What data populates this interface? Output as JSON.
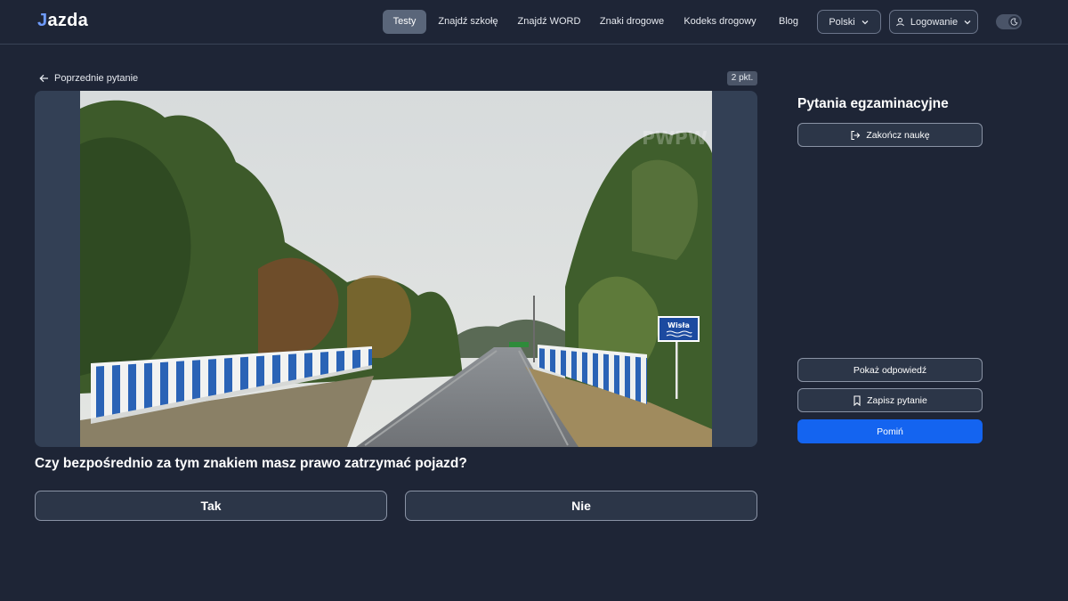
{
  "header": {
    "logo_mark": "J",
    "logo_rest": "azda",
    "nav": [
      {
        "label": "Testy",
        "active": true
      },
      {
        "label": "Znajdź szkołę",
        "active": false
      },
      {
        "label": "Znajdź WORD",
        "active": false
      },
      {
        "label": "Znaki drogowe",
        "active": false
      },
      {
        "label": "Kodeks drogowy",
        "active": false
      },
      {
        "label": "Blog",
        "active": false
      }
    ],
    "language": "Polski",
    "login": "Logowanie",
    "theme_toggle_icon": "moon-icon"
  },
  "question_area": {
    "previous_label": "Poprzednie pytanie",
    "points": "2 pkt.",
    "image_sign_text": "Wisła",
    "question_text": "Czy bezpośrednio za tym znakiem masz prawo zatrzymać pojazd?",
    "answers": [
      "Tak",
      "Nie"
    ]
  },
  "sidebar": {
    "title": "Pytania egzaminacyjne",
    "end_label": "Zakończ naukę",
    "show_answer_label": "Pokaż odpowiedź",
    "save_label": "Zapisz pytanie",
    "skip_label": "Pomiń"
  },
  "colors": {
    "background": "#1e2536",
    "primary": "#1464f0",
    "active_nav": "#5a667a"
  }
}
